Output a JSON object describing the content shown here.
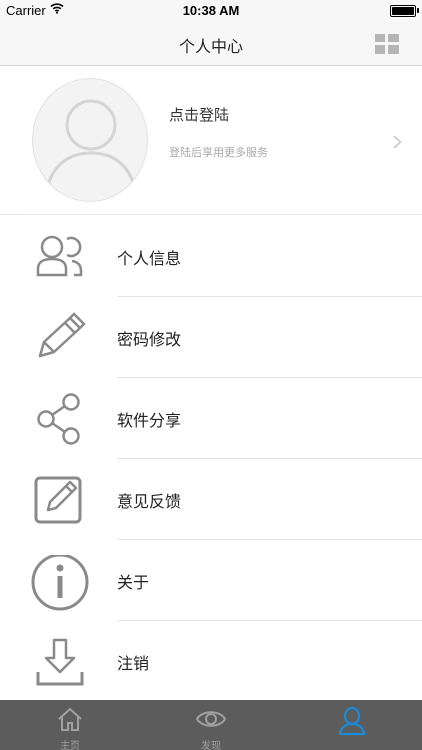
{
  "status_bar": {
    "carrier": "Carrier",
    "time": "10:38 AM",
    "battery_level": 1.0
  },
  "nav": {
    "title": "个人中心",
    "right_icon": "grid-icon"
  },
  "profile": {
    "login_label": "点击登陆",
    "hint": "登陆后享用更多服务",
    "chevron_icon": "chevron-right-icon"
  },
  "menu": {
    "items": [
      {
        "label": "个人信息",
        "icon": "users-icon"
      },
      {
        "label": "密码修改",
        "icon": "pencil-icon"
      },
      {
        "label": "软件分享",
        "icon": "share-icon"
      },
      {
        "label": "意见反馈",
        "icon": "edit-icon"
      },
      {
        "label": "关于",
        "icon": "info-icon"
      },
      {
        "label": "注销",
        "icon": "download-icon"
      }
    ]
  },
  "tabbar": {
    "tabs": [
      {
        "label": "主页",
        "icon": "home-icon",
        "active": false
      },
      {
        "label": "发现",
        "icon": "eye-icon",
        "active": false
      },
      {
        "label": "",
        "icon": "person-icon",
        "active": true
      }
    ]
  },
  "colors": {
    "accent": "#1a8ad6",
    "tabbar_bg": "#5c5c5c",
    "icon_gray": "#8a8a8a"
  }
}
